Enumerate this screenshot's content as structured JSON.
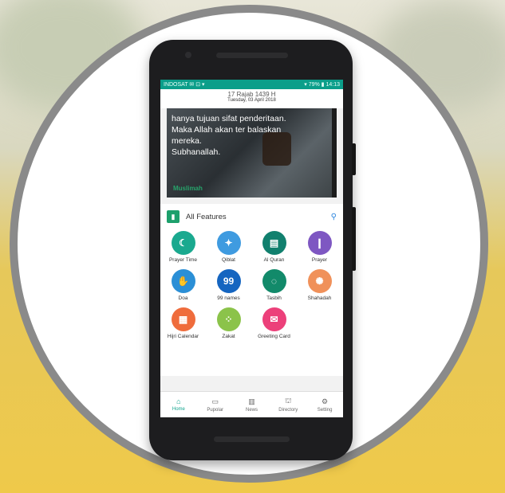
{
  "colors": {
    "accent": "#0b9e8a",
    "icon_green": "#1da06c",
    "pin": "#2e86de"
  },
  "status": {
    "left": "INDOSAT ✉ ⊡ ▾",
    "right": "▾ 79% ▮ 14:13"
  },
  "date": {
    "hijri": "17 Rajab 1439 H",
    "gregorian": "Tuesday, 03 April 2018"
  },
  "hero": {
    "lines": [
      "hanya tujuan sifat penderitaan.",
      "Maka Allah akan ter balaskan",
      "mereka.",
      "Subhanallah."
    ],
    "credit": "Muslimah"
  },
  "features": {
    "title": "All Features",
    "items": [
      {
        "label": "Prayer Time",
        "color": "#1aa98f",
        "icon": "prayer-time-icon",
        "glyph": "☾"
      },
      {
        "label": "Qiblat",
        "color": "#3f9be0",
        "icon": "compass-icon",
        "glyph": "✦"
      },
      {
        "label": "Al Quran",
        "color": "#11806e",
        "icon": "quran-icon",
        "glyph": "▤"
      },
      {
        "label": "Prayer",
        "color": "#7e57c2",
        "icon": "prayer-icon",
        "glyph": "❙"
      },
      {
        "label": "Doa",
        "color": "#2b8fd6",
        "icon": "doa-icon",
        "glyph": "✋"
      },
      {
        "label": "99 names",
        "color": "#1565c0",
        "icon": "ninety-nine-names-icon",
        "glyph": "99"
      },
      {
        "label": "Tasbih",
        "color": "#128a6a",
        "icon": "tasbih-icon",
        "glyph": "◌"
      },
      {
        "label": "Shahadah",
        "color": "#f0915a",
        "icon": "shahadah-icon",
        "glyph": "✺"
      },
      {
        "label": "Hijri Calendar",
        "color": "#ef6c3c",
        "icon": "calendar-icon",
        "glyph": "▦"
      },
      {
        "label": "Zakat",
        "color": "#8bc34a",
        "icon": "zakat-icon",
        "glyph": "⁘"
      },
      {
        "label": "Greeting Card",
        "color": "#ec407a",
        "icon": "greeting-card-icon",
        "glyph": "✉"
      }
    ]
  },
  "nav": [
    {
      "label": "Home",
      "icon": "home-icon",
      "glyph": "⌂",
      "active": true
    },
    {
      "label": "Pupolar",
      "icon": "book-icon",
      "glyph": "▭",
      "active": false
    },
    {
      "label": "News",
      "icon": "news-icon",
      "glyph": "▥",
      "active": false
    },
    {
      "label": "Directory",
      "icon": "mosque-icon",
      "glyph": "⛫",
      "active": false
    },
    {
      "label": "Setting",
      "icon": "setting-icon",
      "glyph": "⚙",
      "active": false
    }
  ]
}
